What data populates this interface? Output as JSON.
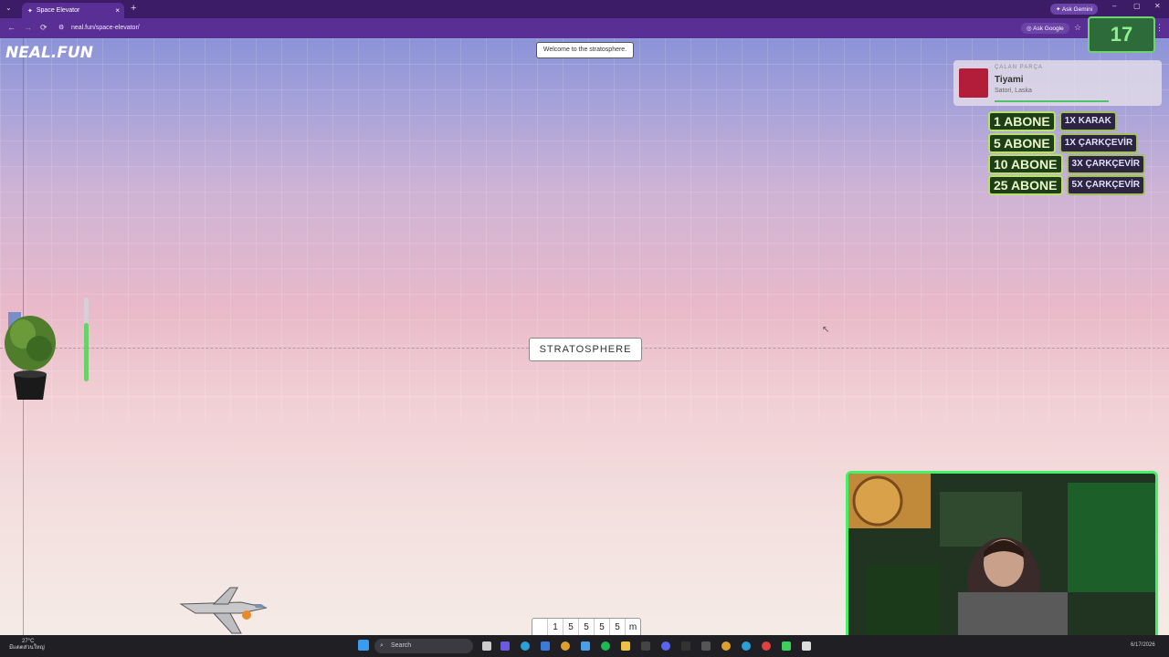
{
  "browser": {
    "tab_title": "Space Elevator",
    "tab_close": "×",
    "new_tab": "+",
    "url": "neal.fun/space-elevator/",
    "ask_gemini": "Ask Gemini",
    "ask_google": "Ask Google"
  },
  "page": {
    "logo": "NEAL.FUN",
    "welcome_message": "Welcome to the stratosphere.",
    "layer_label": "STRATOSPHERE",
    "altitude_digits": [
      "",
      "1",
      "5",
      "5",
      "5",
      "5"
    ],
    "altitude_unit": "m",
    "progress_fraction": 0.7
  },
  "overlay": {
    "timer": "17",
    "now_playing": {
      "label": "ÇALAN PARÇA",
      "title": "Tiyami",
      "artist": "Satori, Laska"
    },
    "sub_goals": [
      {
        "count": "1 ABONE",
        "reward": "1X KARAK"
      },
      {
        "count": "5 ABONE",
        "reward": "1X ÇARKÇEVİR"
      },
      {
        "count": "10 ABONE",
        "reward": "3X ÇARKÇEVİR"
      },
      {
        "count": "25 ABONE",
        "reward": "5X ÇARKÇEVİR"
      }
    ]
  },
  "taskbar": {
    "weather_temp": "27°C",
    "weather_text": "มีแดดส่วนใหญ่",
    "search_placeholder": "Search",
    "date": "6/17/2026"
  },
  "colors": {
    "browser_purple": "#5a2f95",
    "webcam_border": "#47f06a",
    "timer_text": "#8ff08f"
  }
}
